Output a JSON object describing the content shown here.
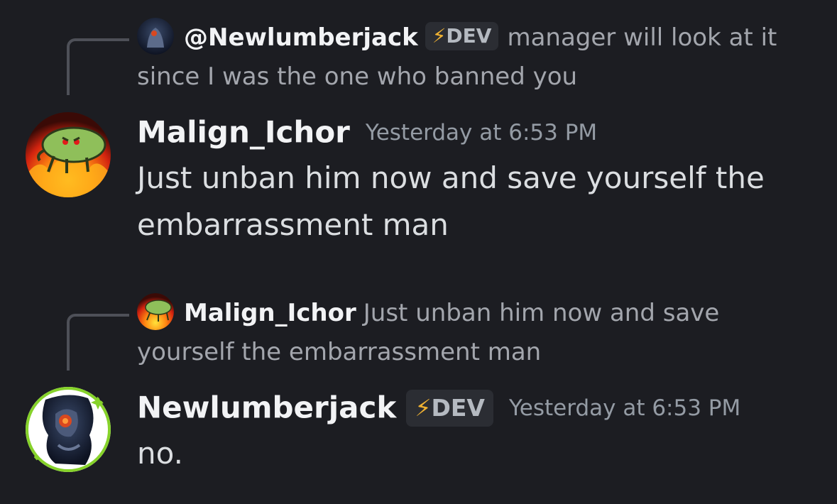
{
  "messages": [
    {
      "reply": {
        "author": "@Newlumberjack",
        "badge_icon": "⚡",
        "badge_label": "DEV",
        "text": "manager will look at it since I was the one who banned you"
      },
      "author": "Malign_Ichor",
      "timestamp": "Yesterday at 6:53 PM",
      "content": "Just unban him now and save yourself the embarrassment man"
    },
    {
      "reply": {
        "author": "Malign_Ichor",
        "text": "Just unban him now and save yourself the embarrassment man"
      },
      "author": "Newlumberjack",
      "badge_icon": "⚡",
      "badge_label": "DEV",
      "timestamp": "Yesterday at 6:53 PM",
      "content": "no."
    }
  ],
  "colors": {
    "background": "#1c1d22",
    "author": "#f2f3f5",
    "muted": "#a3a6ad",
    "badge_bg": "#2b2d33",
    "bolt": "#f0b232",
    "avatar_ring": "#86d22a"
  }
}
